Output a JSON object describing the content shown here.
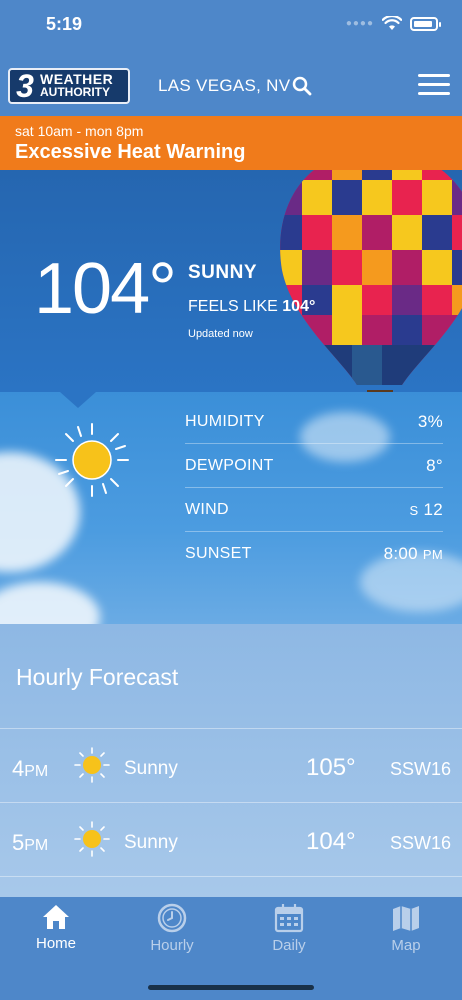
{
  "status": {
    "time": "5:19"
  },
  "header": {
    "logo_number": "3",
    "logo_line1": "WEATHER",
    "logo_line2": "AUTHORITY",
    "location": "LAS VEGAS, NV"
  },
  "warning": {
    "time_range": "sat 10am - mon 8pm",
    "title": "Excessive Heat Warning"
  },
  "current": {
    "temperature": "104°",
    "condition": "SUNNY",
    "feels_like_label": "FEELS LIKE",
    "feels_like_value": "104°",
    "updated": "Updated now",
    "icon": "sun-icon"
  },
  "details": [
    {
      "label": "HUMIDITY",
      "value": "3%"
    },
    {
      "label": "DEWPOINT",
      "value": "8°"
    },
    {
      "label": "WIND",
      "dir": "S",
      "value": "12"
    },
    {
      "label": "SUNSET",
      "value": "8:00",
      "suffix": "PM"
    }
  ],
  "hourly": {
    "title": "Hourly Forecast",
    "rows": [
      {
        "hour": "4",
        "ampm": "PM",
        "condition": "Sunny",
        "temp": "105°",
        "wind": "SSW16",
        "icon": "sun-icon"
      },
      {
        "hour": "5",
        "ampm": "PM",
        "condition": "Sunny",
        "temp": "104°",
        "wind": "SSW16",
        "icon": "sun-icon"
      }
    ]
  },
  "tabs": [
    {
      "label": "Home",
      "icon": "home-icon",
      "active": true
    },
    {
      "label": "Hourly",
      "icon": "clock-icon",
      "active": false
    },
    {
      "label": "Daily",
      "icon": "calendar-icon",
      "active": false
    },
    {
      "label": "Map",
      "icon": "map-icon",
      "active": false
    }
  ],
  "colors": {
    "header_bg": "#4e87c9",
    "warning_bg": "#f07b1b",
    "sun": "#f7c21a"
  }
}
